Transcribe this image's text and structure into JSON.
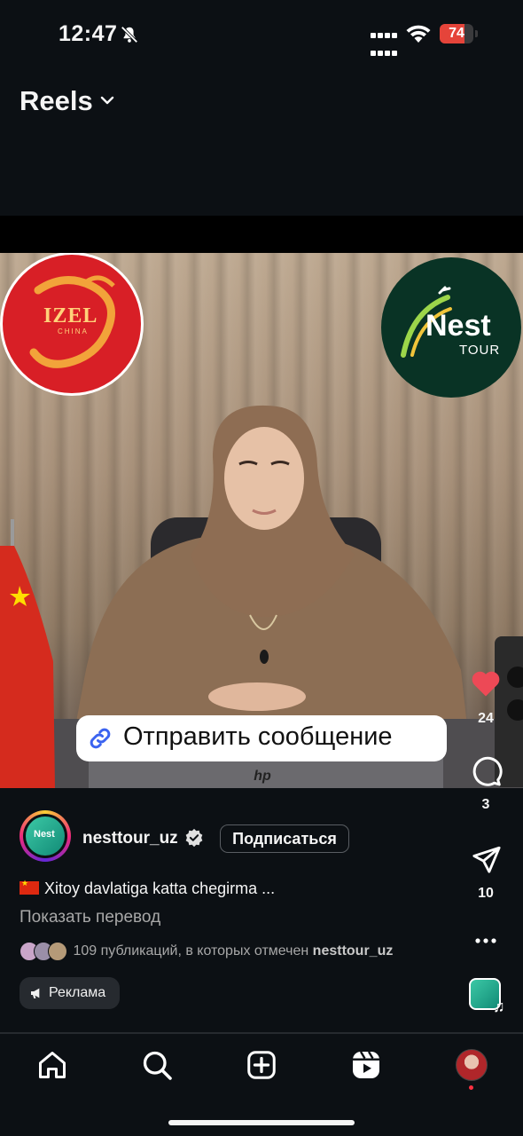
{
  "status_bar": {
    "time": "12:47",
    "battery": "74",
    "battery_level_percent": 74
  },
  "header": {
    "title": "Reels"
  },
  "video": {
    "left_logo_text": "IZEL",
    "left_logo_sub": "CHINA",
    "right_logo_text": "Nest",
    "right_logo_sub": "TOUR",
    "send_message_label": "Отправить сообщение",
    "laptop_brand": "hp"
  },
  "rail": {
    "likes": "24",
    "comments": "3",
    "shares": "10"
  },
  "post": {
    "username": "nesttour_uz",
    "follow_label": "Подписаться",
    "caption": "Xitoy davlatiga katta chegirma ...",
    "translate_label": "Показать перевод",
    "tagged_text": "109 публикаций, в которых отмечен",
    "tagged_user": "nesttour_uz",
    "ad_label": "Реклама"
  },
  "colors": {
    "like": "#ed4956",
    "background": "#0c1014",
    "avatar": "#1fa98d"
  },
  "nav": [
    "home-icon",
    "search-icon",
    "create-icon",
    "reels-icon",
    "profile-avatar"
  ]
}
